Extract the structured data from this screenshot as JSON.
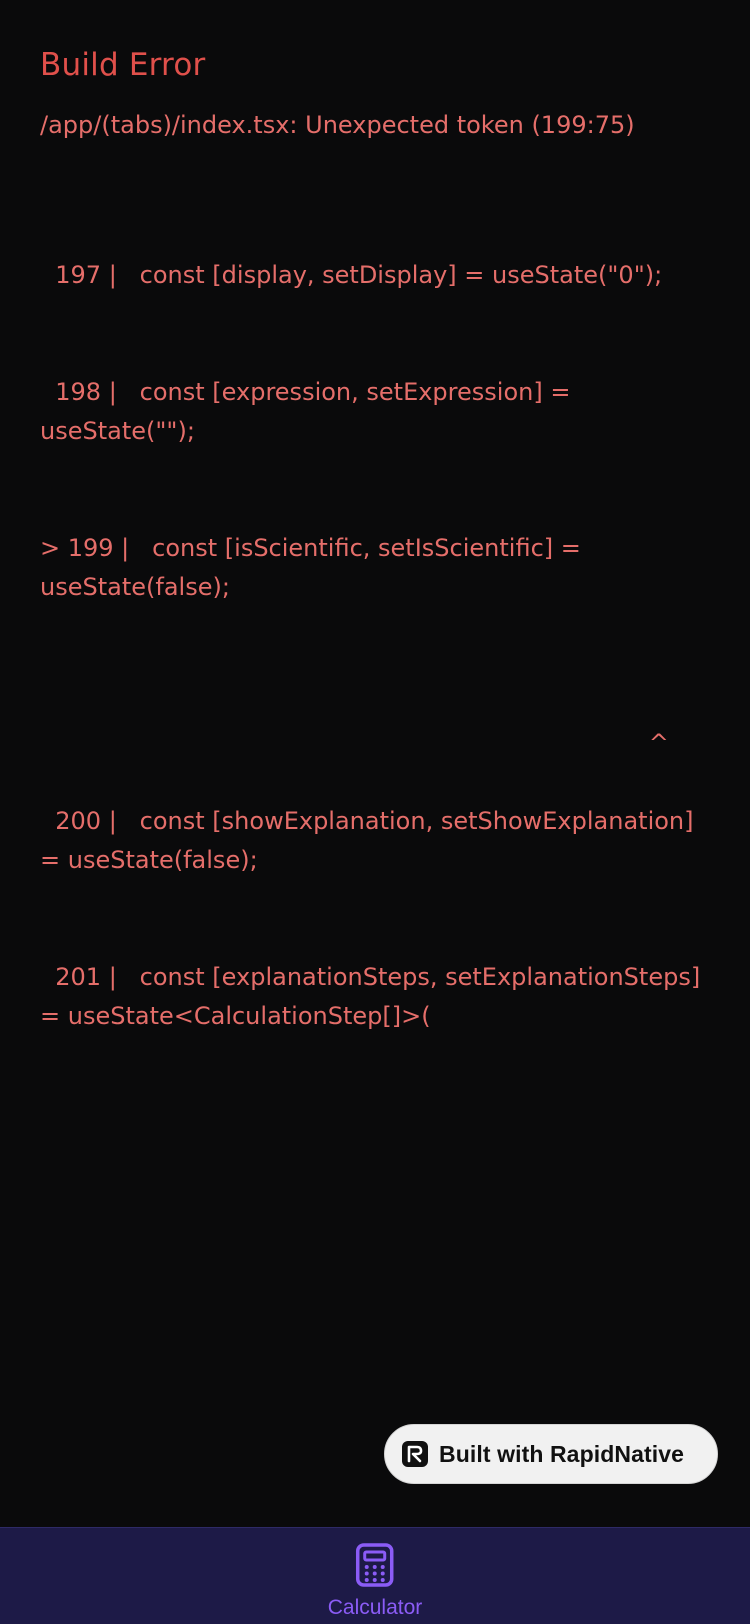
{
  "error": {
    "title": "Build Error",
    "message": "/app/(tabs)/index.tsx: Unexpected token (199:75)",
    "code_lines": [
      "  197 |   const [display, setDisplay] = useState(\"0\");",
      "  198 |   const [expression, setExpression] = useState(\"\");",
      "> 199 |   const [isScientific, setIsScientific] = useState(false);",
      "^",
      "  200 |   const [showExplanation, setShowExplanation] = useState(false);",
      "  201 |   const [explanationSteps, setExplanationSteps] = useState<CalculationStep[]>("
    ]
  },
  "badge": {
    "label": "Built with RapidNative",
    "logo_icon": "rapidnative-logo-icon"
  },
  "tab_bar": {
    "tabs": [
      {
        "label": "Calculator",
        "icon": "calculator-icon",
        "active": true
      }
    ]
  },
  "colors": {
    "background": "#0a0a0b",
    "error_title": "#e0504b",
    "error_text": "#e56e6a",
    "tab_bar": "#1d1a47",
    "accent": "#8b5cf6",
    "badge_background": "#f1f1f1"
  }
}
